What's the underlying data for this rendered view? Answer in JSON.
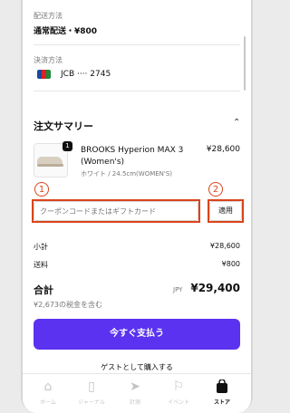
{
  "shipping": {
    "label": "配送方法",
    "value": "通常配送・¥800"
  },
  "payment": {
    "label": "決済方法",
    "card_text": "JCB ···· 2745"
  },
  "summary": {
    "title": "注文サマリー",
    "collapse_icon": "chevron-up-icon",
    "item": {
      "qty": "1",
      "name_line1": "BROOKS Hyperion MAX 3",
      "name_line2": "(Women's)",
      "variant": "ホワイト / 24.5cm(WOMEN'S)",
      "price": "¥28,600"
    }
  },
  "coupon": {
    "placeholder": "クーポンコードまたはギフトカード",
    "apply_label": "適用"
  },
  "annotations": {
    "one": "1",
    "two": "2",
    "color": "#d9441a"
  },
  "totals": {
    "subtotal_label": "小計",
    "subtotal_value": "¥28,600",
    "shipping_label": "送料",
    "shipping_value": "¥800",
    "total_label": "合計",
    "currency": "JPY",
    "total_value": "¥29,400",
    "tax_note": "¥2,673の税金を含む"
  },
  "actions": {
    "pay_now": "今すぐ支払う",
    "guest": "ゲストとして購入する",
    "accent": "#5a32f0"
  },
  "tabbar": [
    {
      "label": "ホーム",
      "icon": "home-icon"
    },
    {
      "label": "ジャーナル",
      "icon": "journal-icon"
    },
    {
      "label": "計測",
      "icon": "measure-icon"
    },
    {
      "label": "イベント",
      "icon": "flag-icon"
    },
    {
      "label": "ストア",
      "icon": "shopping-bag-icon",
      "active": true
    }
  ]
}
